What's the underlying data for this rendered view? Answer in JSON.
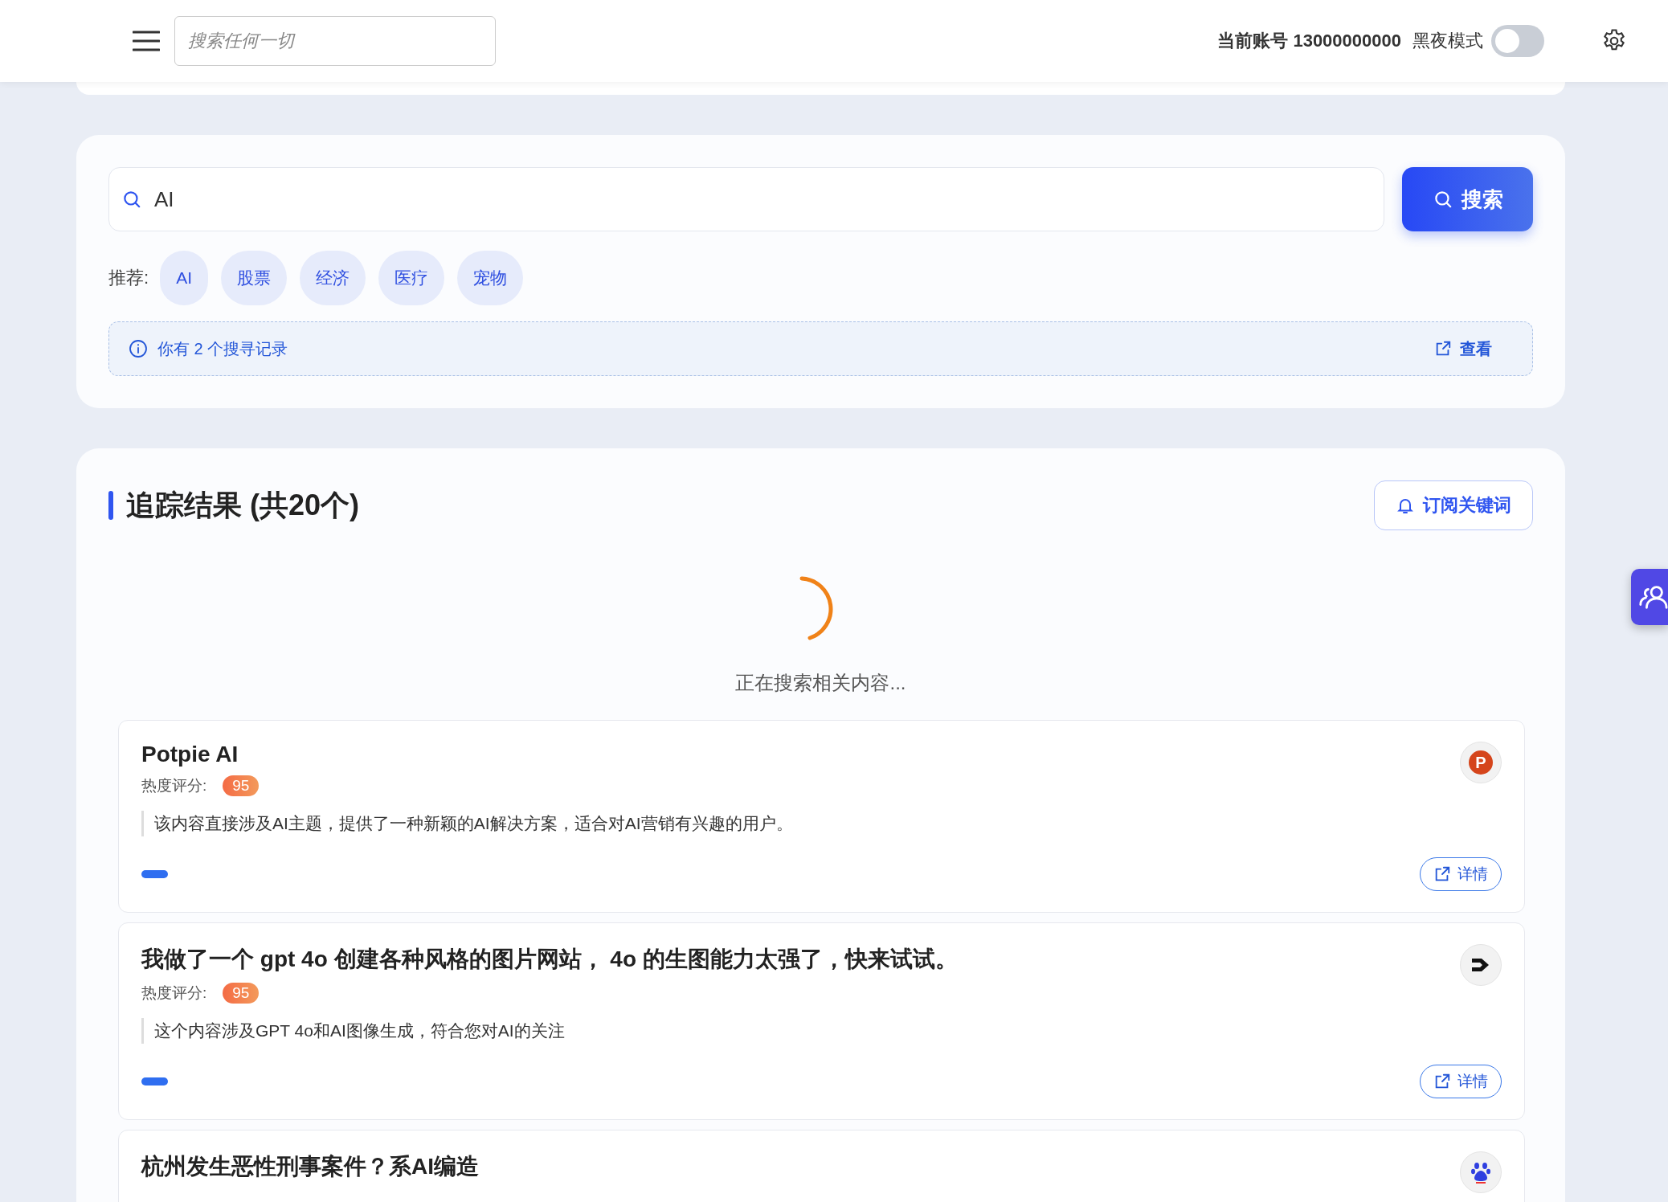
{
  "header": {
    "search_placeholder": "搜索任何一切",
    "account_label": "当前账号 13000000000",
    "dark_mode": {
      "label": "黑夜模式",
      "on": false
    }
  },
  "search": {
    "value": "AI",
    "button": "搜索",
    "suggest_label": "推荐:",
    "suggestions": [
      "AI",
      "股票",
      "经济",
      "医疗",
      "宠物"
    ],
    "history": {
      "text": "你有 2 个搜寻记录",
      "action": "查看"
    }
  },
  "results": {
    "title": "追踪结果 (共20个)",
    "subscribe": "订阅关键词",
    "loading": "正在搜索相关内容...",
    "items": [
      {
        "title": "Potpie AI",
        "score_label": "热度评分:",
        "score": "95",
        "summary": "该内容直接涉及AI主题，提供了一种新颖的AI解决方案，适合对AI营销有兴趣的用户。",
        "detail": "详情",
        "source": {
          "kind": "letter",
          "letter": "P"
        }
      },
      {
        "title": "我做了一个 gpt 4o 创建各种风格的图片网站， 4o 的生图能力太强了，快来试试。",
        "score_label": "热度评分:",
        "score": "95",
        "summary": "这个内容涉及GPT 4o和AI图像生成，符合您对AI的关注",
        "detail": "详情",
        "source": {
          "kind": "arrow"
        }
      },
      {
        "title": "杭州发生恶性刑事案件？系AI编造",
        "source": {
          "kind": "paw"
        }
      }
    ]
  }
}
